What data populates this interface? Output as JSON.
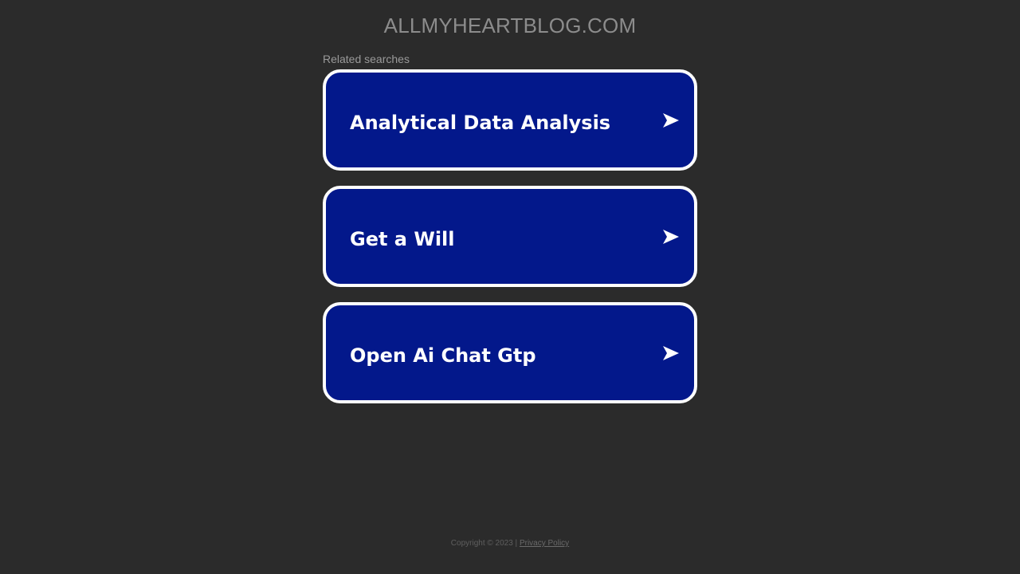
{
  "header": {
    "domain_title": "ALLMYHEARTBLOG.COM"
  },
  "related": {
    "label": "Related searches",
    "items": [
      {
        "label": "Analytical Data Analysis",
        "icon": "arrow-right-icon"
      },
      {
        "label": "Get a Will",
        "icon": "arrow-right-icon"
      },
      {
        "label": "Open Ai Chat Gtp",
        "icon": "arrow-right-icon"
      }
    ]
  },
  "footer": {
    "copyright": "Copyright © 2023 |",
    "privacy_label": "Privacy Policy"
  },
  "colors": {
    "background": "#2b2b2b",
    "card_fill": "#03188b",
    "card_border": "#ffffff",
    "title_text": "#8c8c8c"
  }
}
